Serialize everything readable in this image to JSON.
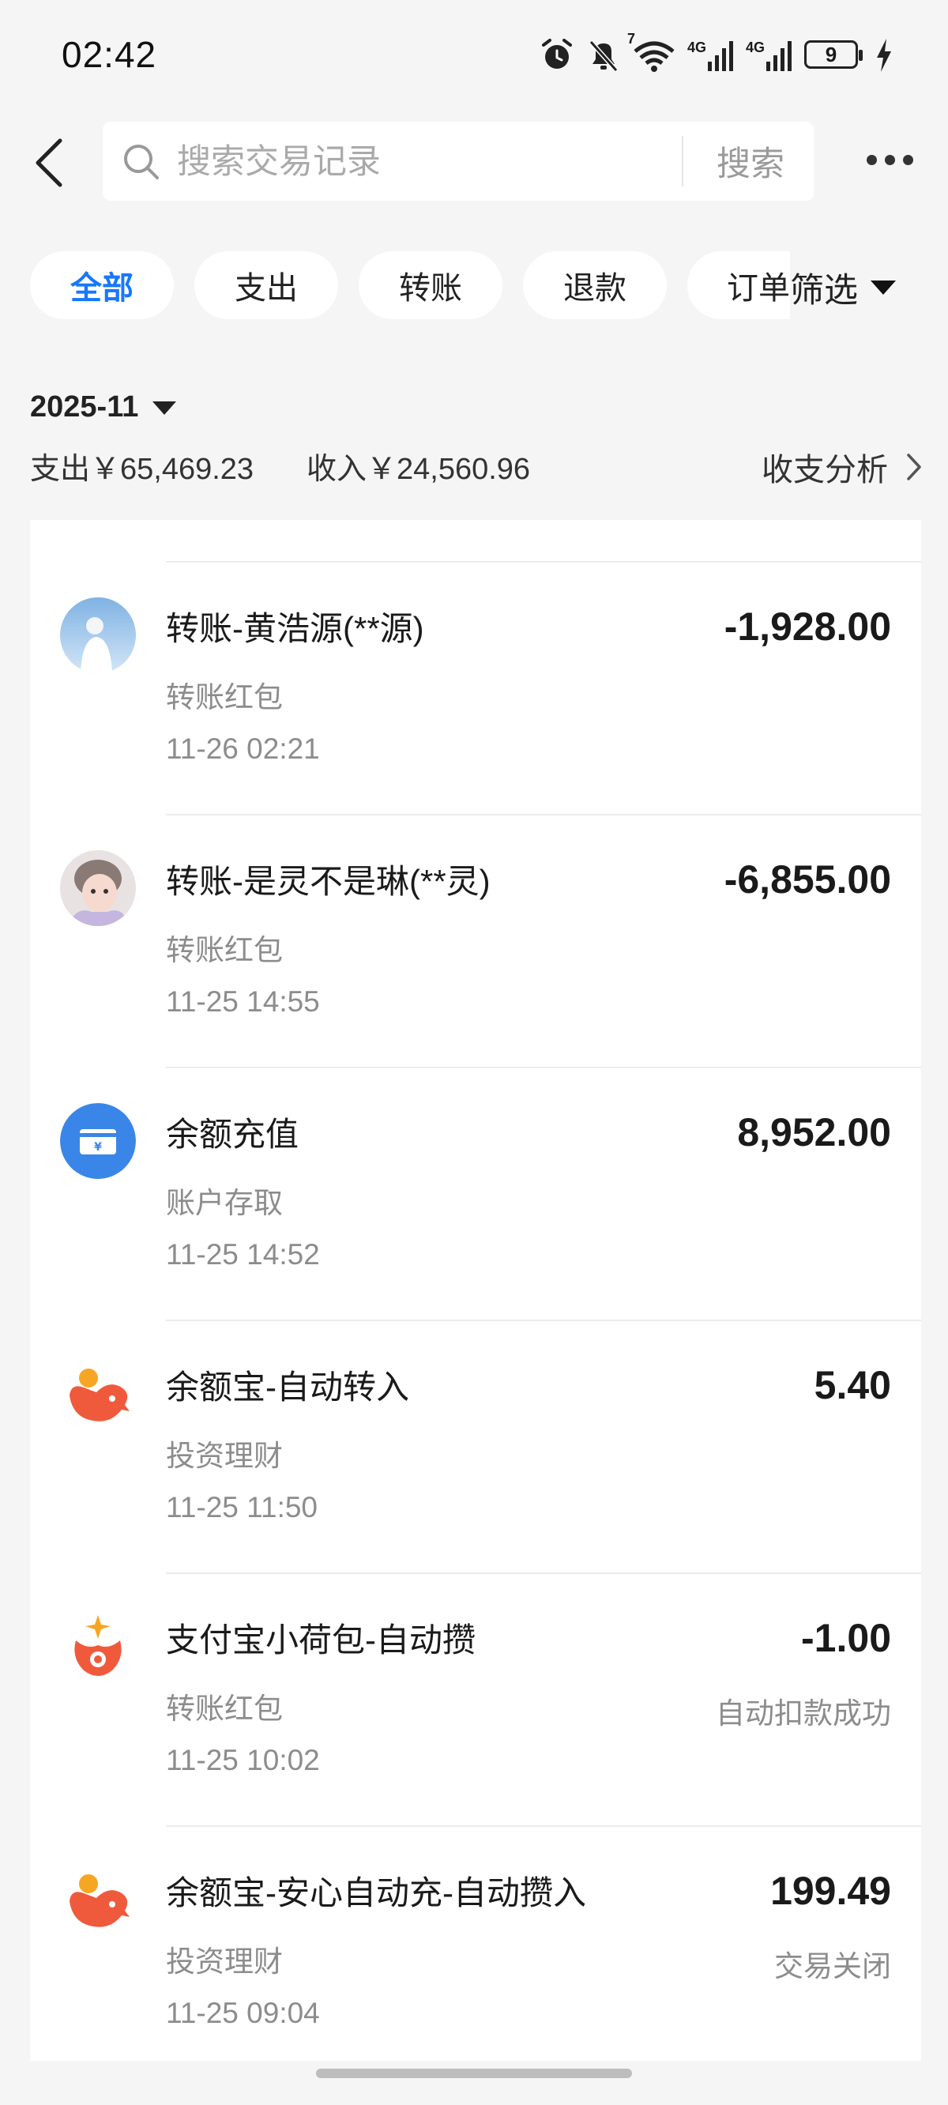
{
  "status_bar": {
    "time": "02:42",
    "wifi_badge": "7",
    "network_1": "4G",
    "network_2": "4G",
    "battery": "9"
  },
  "search": {
    "placeholder": "搜索交易记录",
    "button_label": "搜索"
  },
  "filters": {
    "chips": [
      "全部",
      "支出",
      "转账",
      "退款",
      "订单"
    ],
    "active_index": 0,
    "filter_label": "筛选"
  },
  "summary": {
    "month": "2025-11",
    "expense": "支出￥65,469.23",
    "income": "收入￥24,560.96",
    "analysis_label": "收支分析"
  },
  "transactions": [
    {
      "title": "转账-黄浩源(**源)",
      "category": "转账红包",
      "time": "11-26 02:21",
      "amount": "-1,928.00",
      "status": "",
      "icon": "user-avatar-photo"
    },
    {
      "title": "转账-是灵不是琳(**灵)",
      "category": "转账红包",
      "time": "11-25 14:55",
      "amount": "-6,855.00",
      "status": "",
      "icon": "user-avatar-photo"
    },
    {
      "title": "余额充值",
      "category": "账户存取",
      "time": "11-25 14:52",
      "amount": "8,952.00",
      "status": "",
      "icon": "wallet-icon"
    },
    {
      "title": "余额宝-自动转入",
      "category": "投资理财",
      "time": "11-25 11:50",
      "amount": "5.40",
      "status": "",
      "icon": "yuebao-icon"
    },
    {
      "title": "支付宝小荷包-自动攒",
      "category": "转账红包",
      "time": "11-25 10:02",
      "amount": "-1.00",
      "status": "自动扣款成功",
      "icon": "xiaohebao-icon"
    },
    {
      "title": "余额宝-安心自动充-自动攒入",
      "category": "投资理财",
      "time": "11-25 09:04",
      "amount": "199.49",
      "status": "交易关闭",
      "icon": "yuebao-icon"
    }
  ],
  "colors": {
    "accent": "#1677ff",
    "background": "#f5f5f5",
    "yuebao": "#f05a3c",
    "wallet": "#3a86e8"
  }
}
